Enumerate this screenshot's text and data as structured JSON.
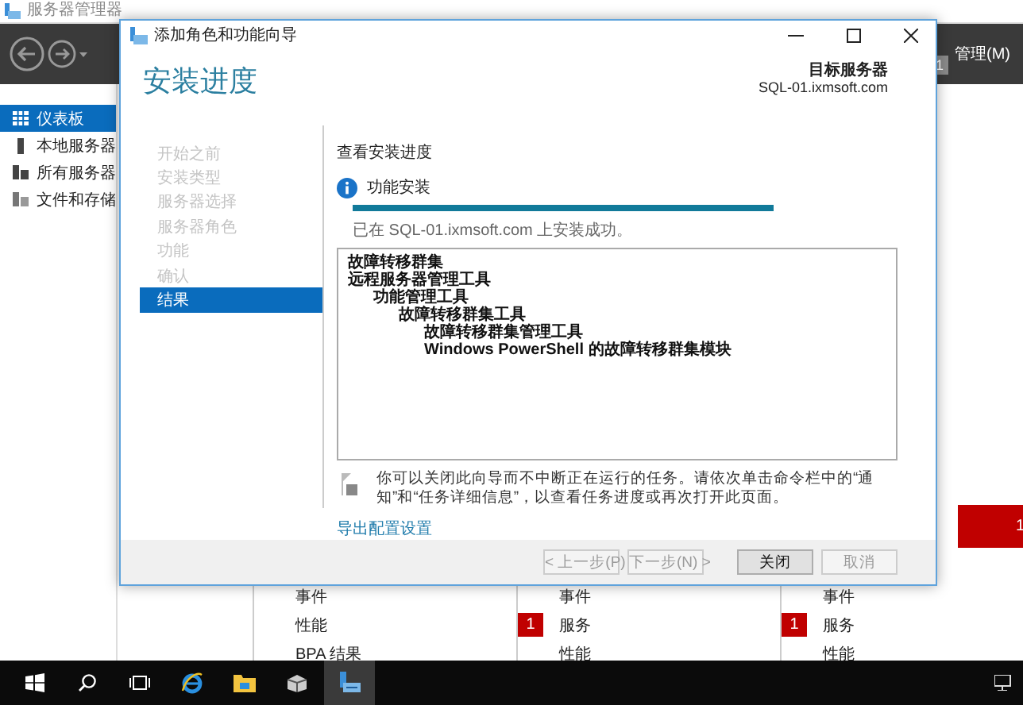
{
  "app": {
    "title": "服务器管理器",
    "menu": "管理(M)",
    "notification_count": "1",
    "sidebar": [
      {
        "label": "仪表板",
        "kind": "dashboard",
        "selected": true
      },
      {
        "label": "本地服务器",
        "kind": "server",
        "selected": false
      },
      {
        "label": "所有服务器",
        "kind": "servers",
        "selected": false
      },
      {
        "label": "文件和存储",
        "kind": "storage",
        "selected": false
      }
    ],
    "alert_count": "1",
    "tiles": [
      {
        "items": [
          {
            "label": "事件"
          },
          {
            "label": "性能"
          },
          {
            "label": "BPA 结果"
          }
        ]
      },
      {
        "items": [
          {
            "label": "事件"
          },
          {
            "label": "服务",
            "badge": "1"
          },
          {
            "label": "性能"
          }
        ]
      },
      {
        "items": [
          {
            "label": "事件"
          },
          {
            "label": "服务",
            "badge": "1"
          },
          {
            "label": "性能"
          }
        ]
      }
    ]
  },
  "dialog": {
    "title": "添加角色和功能向导",
    "heading": "安装进度",
    "target_label": "目标服务器",
    "target_server": "SQL-01.ixmsoft.com",
    "steps": [
      {
        "label": "开始之前",
        "selected": false
      },
      {
        "label": "安装类型",
        "selected": false
      },
      {
        "label": "服务器选择",
        "selected": false
      },
      {
        "label": "服务器角色",
        "selected": false
      },
      {
        "label": "功能",
        "selected": false
      },
      {
        "label": "确认",
        "selected": false
      },
      {
        "label": "结果",
        "selected": true
      }
    ],
    "section_title": "查看安装进度",
    "task_title": "功能安装",
    "level": 1,
    "status": "已在 SQL-01.ixmsoft.com 上安装成功。",
    "results": [
      {
        "label": "故障转移群集"
      },
      {
        "label": "远程服务器管理工具",
        "children": [
          {
            "label": "功能管理工具",
            "children": [
              {
                "label": "故障转移群集工具",
                "children": [
                  {
                    "label": "故障转移群集管理工具"
                  },
                  {
                    "label": "Windows PowerShell 的故障转移群集模块"
                  }
                ]
              }
            ]
          }
        ]
      }
    ],
    "note": "你可以关闭此向导而不中断正在运行的任务。请依次单击命令栏中的“通知”和“任务详细信息”，以查看任务进度或再次打开此页面。",
    "export_link": "导出配置设置",
    "buttons": [
      {
        "label": "< 上一步(P)",
        "disabled": true
      },
      {
        "label": "下一步(N) >",
        "disabled": true
      },
      {
        "label": "关闭",
        "disabled": false
      },
      {
        "label": "取消",
        "disabled": true
      }
    ]
  },
  "taskbar": [
    {
      "kind": "start",
      "selected": false
    },
    {
      "kind": "search",
      "selected": false
    },
    {
      "kind": "taskview",
      "selected": false
    },
    {
      "kind": "browser",
      "selected": false
    },
    {
      "kind": "folder",
      "selected": false
    },
    {
      "kind": "box",
      "selected": false
    },
    {
      "kind": "servermanager",
      "selected": true
    }
  ]
}
